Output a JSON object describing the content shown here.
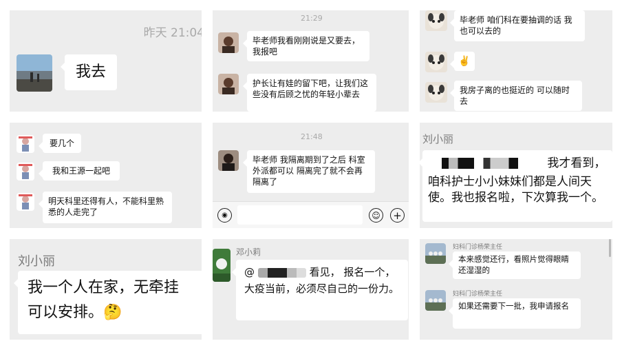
{
  "p1": {
    "time": "昨天 21:04",
    "msg": "我去"
  },
  "p2": {
    "time": "21:29",
    "msg1": "毕老师我看刚刚说是又要去，我报吧",
    "msg2": "护长让有娃的留下吧，让我们这些没有后顾之忧的年轻小辈去"
  },
  "p3": {
    "msg1": "毕老师 咱们科在要抽调的话 我也可以去的",
    "msg2": "✌️",
    "msg3": "我房子离的也挺近的 可以随时去"
  },
  "p4": {
    "msg1": "要几个",
    "msg2": "我和王源一起吧",
    "msg3": "明天科里还得有人，不能科里熟悉的人走完了"
  },
  "p5": {
    "time": "21:48",
    "msg": "毕老师 我隔离期到了之后 科室外派都可以 隔离完了就不会再隔离了"
  },
  "p6": {
    "name": "刘小丽",
    "msg_tail": "我才看到，",
    "msg_rest": "咱科护士小小妹妹们都是人间天使。我也报名啦，下次算我一个。"
  },
  "p7": {
    "name": "刘小丽",
    "msg": "我一个人在家，无牵挂",
    "msg2": "可以安排。",
    "emoji": "🤔"
  },
  "p8": {
    "name": "邓小莉",
    "msg_head": "@",
    "msg_tail": "看见， 报名一个，",
    "msg_rest": "大疫当前，必须尽自己的一份力。"
  },
  "p9": {
    "name1": "妇科门诊杨荣主任",
    "msg1": "本来感觉还行，看照片觉得眼睛还湿湿的",
    "name2": "妇科门诊杨荣主任",
    "msg2": "如果还需要下一批，我申请报名"
  },
  "icons": [
    "voice-icon",
    "emoji-icon",
    "plus-icon"
  ],
  "colors": {
    "panel_bg": "#ededed",
    "bubble_bg": "#ffffff",
    "timestamp": "#a9a9a9"
  }
}
